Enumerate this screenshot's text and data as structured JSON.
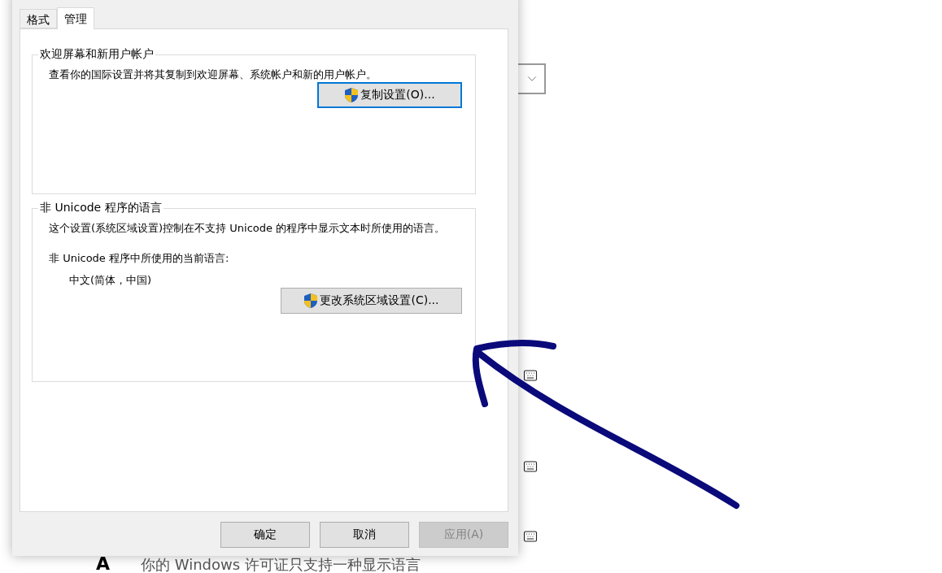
{
  "dialog": {
    "tabs": [
      {
        "label": "格式",
        "selected": false
      },
      {
        "label": "管理",
        "selected": true
      }
    ],
    "groups": [
      {
        "title": "欢迎屏幕和新用户帐户",
        "description": "查看你的国际设置并将其复制到欢迎屏幕、系统帐户和新的用户帐户。",
        "button": {
          "label": "复制设置(O)...",
          "focused": true
        }
      },
      {
        "title": "非 Unicode 程序的语言",
        "description": "这个设置(系统区域设置)控制在不支持 Unicode 的程序中显示文本时所使用的语言。",
        "current_label": "非 Unicode 程序中所使用的当前语言:",
        "current_value": "中文(简体，中国)",
        "button": {
          "label": "更改系统区域设置(C)...",
          "focused": false
        }
      }
    ],
    "buttons": [
      {
        "label": "确定",
        "disabled": false
      },
      {
        "label": "取消",
        "disabled": false
      },
      {
        "label": "应用(A)",
        "disabled": true
      }
    ]
  },
  "background": {
    "glyph": "A",
    "notice": "你的 Windows 许可证只支持一种显示语言"
  }
}
